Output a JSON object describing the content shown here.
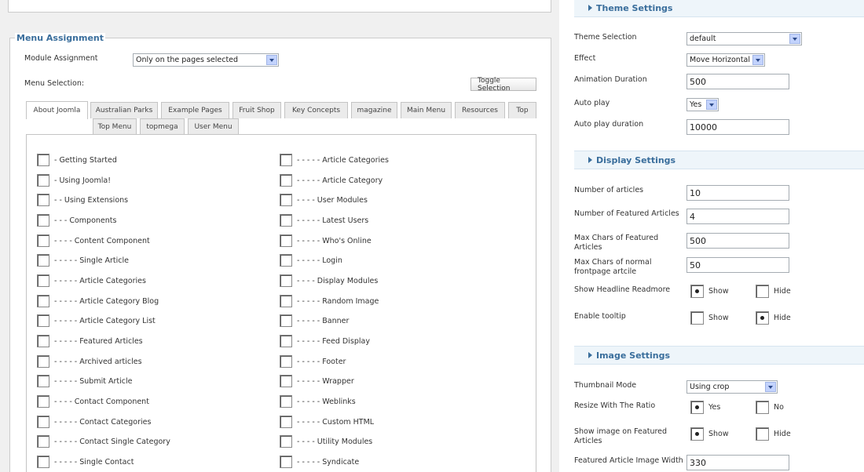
{
  "menu_assignment": {
    "legend": "Menu Assignment",
    "module_assignment_label": "Module Assignment",
    "module_assignment_value": "Only on the pages selected",
    "menu_selection_label": "Menu Selection:",
    "toggle_button": "Toggle Selection",
    "tabs_row1": [
      "About Joomla",
      "Australian Parks",
      "Example Pages",
      "Fruit Shop",
      "Key Concepts",
      "magazine",
      "Main Menu",
      "Resources",
      "Top"
    ],
    "tabs_row2": [
      "Top Menu",
      "topmega",
      "User Menu"
    ],
    "left_items": [
      "- Getting Started",
      "- Using Joomla!",
      "- - Using Extensions",
      "- - - Components",
      "- - - - Content Component",
      "- - - - - Single Article",
      "- - - - - Article Categories",
      "- - - - - Article Category Blog",
      "- - - - - Article Category List",
      "- - - - - Featured Articles",
      "- - - - - Archived articles",
      "- - - - - Submit Article",
      "- - - - Contact Component",
      "- - - - - Contact Categories",
      "- - - - - Contact Single Category",
      "- - - - - Single Contact"
    ],
    "right_items": [
      "- - - - - Article Categories",
      "- - - - - Article Category",
      "- - - - User Modules",
      "- - - - - Latest Users",
      "- - - - - Who's Online",
      "- - - - - Login",
      "- - - - Display Modules",
      "- - - - - Random Image",
      "- - - - - Banner",
      "- - - - - Feed Display",
      "- - - - - Footer",
      "- - - - - Wrapper",
      "- - - - - Weblinks",
      "- - - - - Custom HTML",
      "- - - - Utility Modules",
      "- - - - - Syndicate"
    ]
  },
  "theme_settings": {
    "header": "Theme Settings",
    "theme_selection_label": "Theme Selection",
    "theme_selection_value": "default",
    "effect_label": "Effect",
    "effect_value": "Move Horizontal",
    "animation_duration_label": "Animation Duration",
    "animation_duration_value": "500",
    "auto_play_label": "Auto play",
    "auto_play_value": "Yes",
    "auto_play_duration_label": "Auto play duration",
    "auto_play_duration_value": "10000"
  },
  "display_settings": {
    "header": "Display Settings",
    "num_articles_label": "Number of articles",
    "num_articles_value": "10",
    "num_featured_label": "Number of Featured Articles",
    "num_featured_value": "4",
    "max_chars_featured_label": "Max Chars of Featured Articles",
    "max_chars_featured_value": "500",
    "max_chars_normal_label": "Max Chars of normal frontpage artcile",
    "max_chars_normal_value": "50",
    "headline_readmore_label": "Show Headline Readmore",
    "tooltip_label": "Enable tooltip",
    "show_label": "Show",
    "hide_label": "Hide"
  },
  "image_settings": {
    "header": "Image Settings",
    "thumbnail_mode_label": "Thumbnail Mode",
    "thumbnail_mode_value": "Using crop",
    "resize_ratio_label": "Resize With The Ratio",
    "yes_label": "Yes",
    "no_label": "No",
    "show_image_featured_label": "Show image on Featured Articles",
    "show_label": "Show",
    "hide_label": "Hide",
    "featured_image_width_label": "Featured Article Image Width",
    "featured_image_width_value": "330"
  }
}
